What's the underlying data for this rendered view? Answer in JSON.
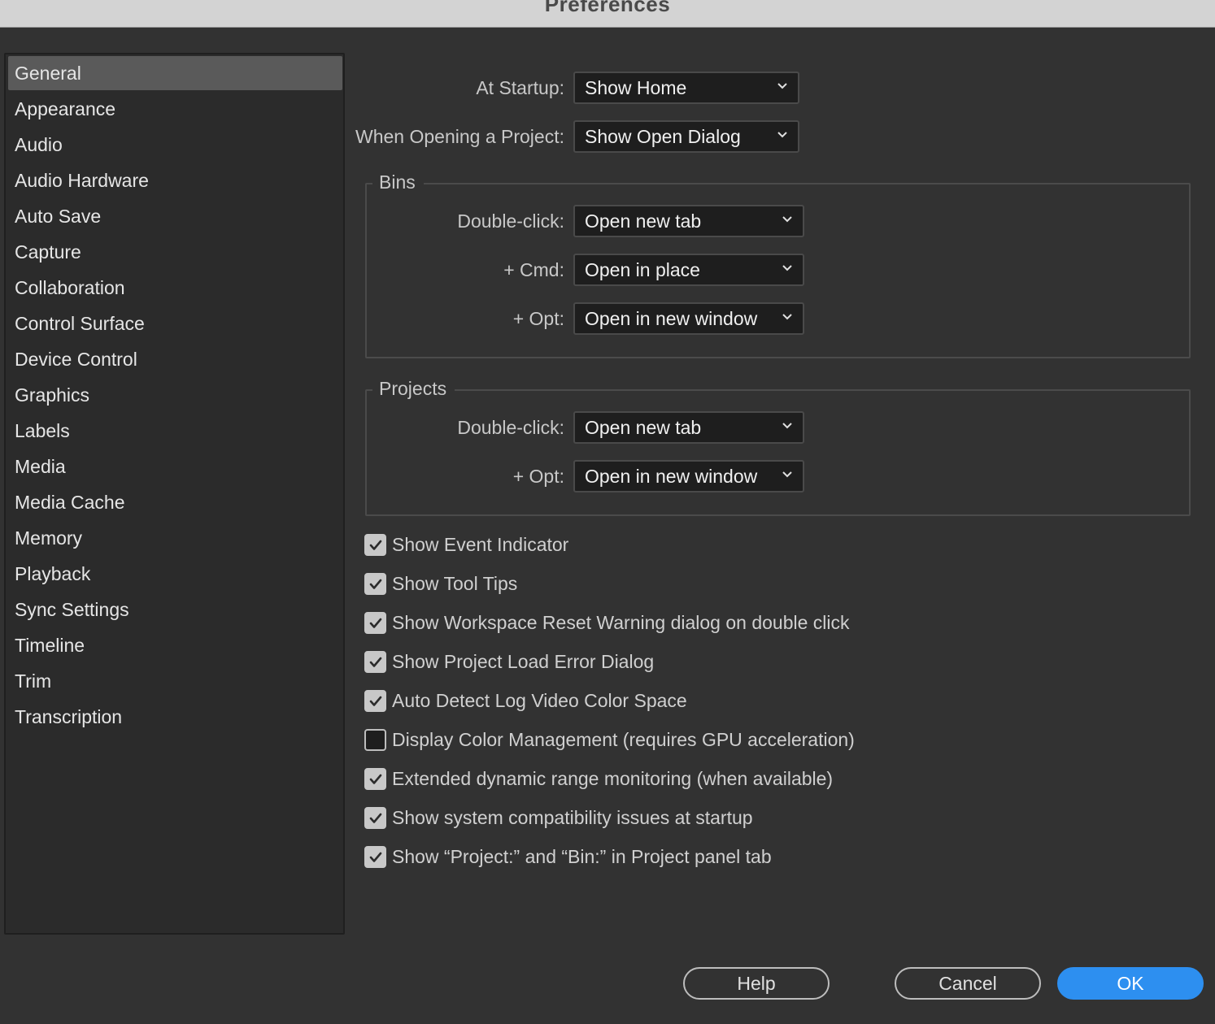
{
  "window": {
    "title": "Preferences"
  },
  "sidebar": {
    "items": [
      {
        "label": "General",
        "selected": true
      },
      {
        "label": "Appearance"
      },
      {
        "label": "Audio"
      },
      {
        "label": "Audio Hardware"
      },
      {
        "label": "Auto Save"
      },
      {
        "label": "Capture"
      },
      {
        "label": "Collaboration"
      },
      {
        "label": "Control Surface"
      },
      {
        "label": "Device Control"
      },
      {
        "label": "Graphics"
      },
      {
        "label": "Labels"
      },
      {
        "label": "Media"
      },
      {
        "label": "Media Cache"
      },
      {
        "label": "Memory"
      },
      {
        "label": "Playback"
      },
      {
        "label": "Sync Settings"
      },
      {
        "label": "Timeline"
      },
      {
        "label": "Trim"
      },
      {
        "label": "Transcription"
      }
    ]
  },
  "general": {
    "at_startup": {
      "label": "At Startup:",
      "value": "Show Home"
    },
    "when_opening": {
      "label": "When Opening a Project:",
      "value": "Show Open Dialog"
    }
  },
  "bins": {
    "title": "Bins",
    "double_click": {
      "label": "Double-click:",
      "value": "Open new tab"
    },
    "cmd": {
      "label": "+ Cmd:",
      "value": "Open in place"
    },
    "opt": {
      "label": "+ Opt:",
      "value": "Open in new window"
    }
  },
  "projects": {
    "title": "Projects",
    "double_click": {
      "label": "Double-click:",
      "value": "Open new tab"
    },
    "opt": {
      "label": "+ Opt:",
      "value": "Open in new window"
    }
  },
  "checkboxes": [
    {
      "label": "Show Event Indicator",
      "checked": true
    },
    {
      "label": "Show Tool Tips",
      "checked": true
    },
    {
      "label": "Show Workspace Reset Warning dialog on double click",
      "checked": true
    },
    {
      "label": "Show Project Load Error Dialog",
      "checked": true
    },
    {
      "label": "Auto Detect Log Video Color Space",
      "checked": true
    },
    {
      "label": "Display Color Management (requires GPU acceleration)",
      "checked": false
    },
    {
      "label": "Extended dynamic range monitoring (when available)",
      "checked": true
    },
    {
      "label": "Show system compatibility issues at startup",
      "checked": true
    },
    {
      "label": "Show “Project:” and “Bin:” in Project panel tab",
      "checked": true
    }
  ],
  "buttons": {
    "help": "Help",
    "cancel": "Cancel",
    "ok": "OK"
  },
  "colors": {
    "accent": "#2d8ff0",
    "background": "#323232",
    "sidebar_selected": "#5a5a5a"
  }
}
